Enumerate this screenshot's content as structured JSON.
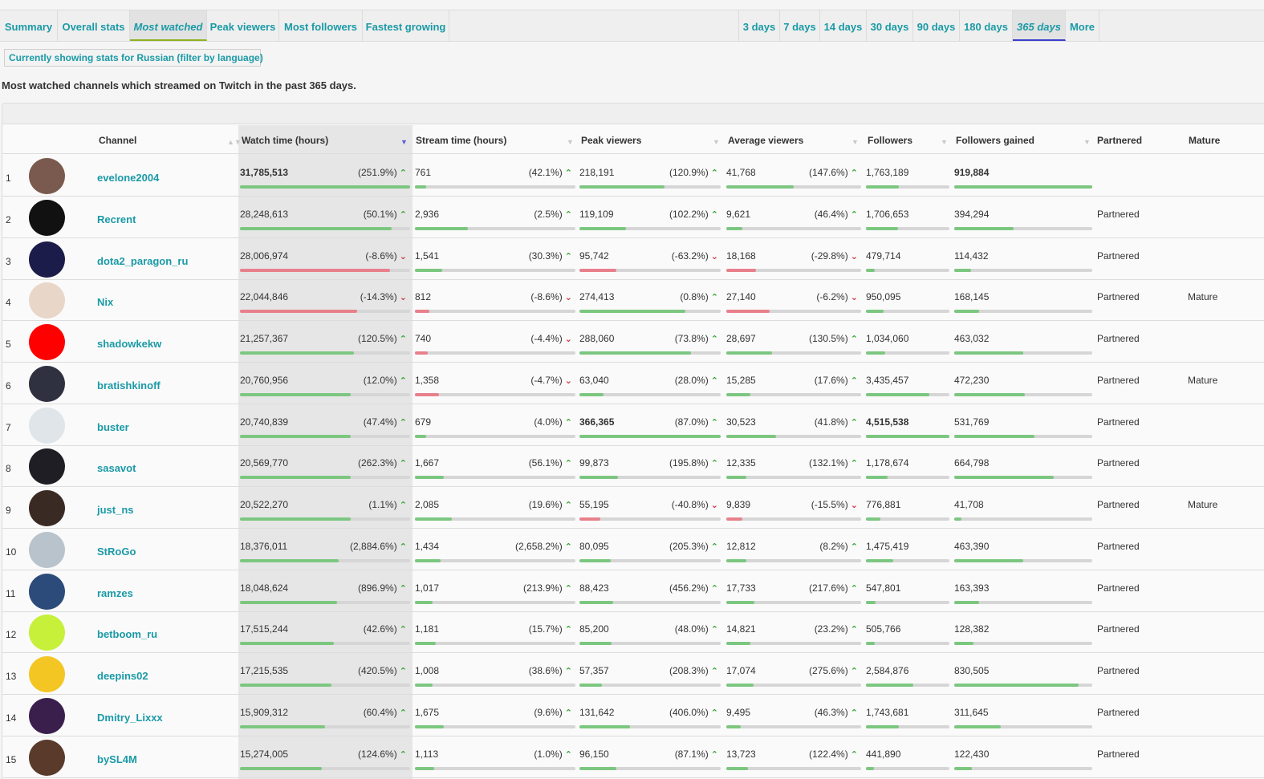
{
  "nav": {
    "left_tabs": [
      "Summary",
      "Overall stats",
      "Most watched",
      "Peak viewers",
      "Most followers",
      "Fastest growing"
    ],
    "right_tabs": [
      "3 days",
      "7 days",
      "14 days",
      "30 days",
      "90 days",
      "180 days",
      "365 days",
      "More"
    ],
    "active_left": "Most watched",
    "active_right": "365 days"
  },
  "filter_label": "Currently showing stats for Russian (filter by language)",
  "description": "Most watched channels which streamed on Twitch in the past 365 days.",
  "columns": {
    "channel": "Channel",
    "watch": "Watch time (hours)",
    "stream": "Stream time (hours)",
    "peak": "Peak viewers",
    "avg": "Average viewers",
    "followers": "Followers",
    "gained": "Followers gained",
    "partnered": "Partnered",
    "mature": "Mature"
  },
  "colors": {
    "link": "#1a9aa6",
    "bar_positive": "#7cc780",
    "bar_negative": "#e8808c",
    "arrow_up": "#2aa02a",
    "arrow_down": "#cf2a3a"
  },
  "rows": [
    {
      "rank": "1",
      "channel": "evelone2004",
      "avatar": "avatar-icon",
      "avatar_color": "#7a5a4e",
      "watch": {
        "value": "31,785,513",
        "pct": "(251.9%)",
        "dir": "up",
        "bar": 1.0,
        "bold": true
      },
      "stream": {
        "value": "761",
        "pct": "(42.1%)",
        "dir": "up",
        "bar": 0.07
      },
      "peak": {
        "value": "218,191",
        "pct": "(120.9%)",
        "dir": "up",
        "bar": 0.6
      },
      "avg": {
        "value": "41,768",
        "pct": "(147.6%)",
        "dir": "up",
        "bar": 0.5
      },
      "followers": {
        "value": "1,763,189",
        "bar": 0.39
      },
      "gained": {
        "value": "919,884",
        "bar": 1.0,
        "bold": true
      },
      "partnered": "",
      "mature": ""
    },
    {
      "rank": "2",
      "channel": "Recrent",
      "avatar": "avatar-icon",
      "avatar_color": "#111111",
      "watch": {
        "value": "28,248,613",
        "pct": "(50.1%)",
        "dir": "up",
        "bar": 0.89
      },
      "stream": {
        "value": "2,936",
        "pct": "(2.5%)",
        "dir": "up",
        "bar": 0.33
      },
      "peak": {
        "value": "119,109",
        "pct": "(102.2%)",
        "dir": "up",
        "bar": 0.33
      },
      "avg": {
        "value": "9,621",
        "pct": "(46.4%)",
        "dir": "up",
        "bar": 0.12
      },
      "followers": {
        "value": "1,706,653",
        "bar": 0.38
      },
      "gained": {
        "value": "394,294",
        "bar": 0.43
      },
      "partnered": "Partnered",
      "mature": ""
    },
    {
      "rank": "3",
      "channel": "dota2_paragon_ru",
      "avatar": "avatar-icon",
      "avatar_color": "#1c1c4a",
      "watch": {
        "value": "28,006,974",
        "pct": "(-8.6%)",
        "dir": "down",
        "bar": 0.88
      },
      "stream": {
        "value": "1,541",
        "pct": "(30.3%)",
        "dir": "up",
        "bar": 0.17
      },
      "peak": {
        "value": "95,742",
        "pct": "(-63.2%)",
        "dir": "down",
        "bar": 0.26
      },
      "avg": {
        "value": "18,168",
        "pct": "(-29.8%)",
        "dir": "down",
        "bar": 0.22
      },
      "followers": {
        "value": "479,714",
        "bar": 0.11
      },
      "gained": {
        "value": "114,432",
        "bar": 0.12
      },
      "partnered": "Partnered",
      "mature": ""
    },
    {
      "rank": "4",
      "channel": "Nix",
      "avatar": "avatar-icon",
      "avatar_color": "#e8d6c8",
      "watch": {
        "value": "22,044,846",
        "pct": "(-14.3%)",
        "dir": "down",
        "bar": 0.69
      },
      "stream": {
        "value": "812",
        "pct": "(-8.6%)",
        "dir": "down",
        "bar": 0.09
      },
      "peak": {
        "value": "274,413",
        "pct": "(0.8%)",
        "dir": "up",
        "bar": 0.75
      },
      "avg": {
        "value": "27,140",
        "pct": "(-6.2%)",
        "dir": "down",
        "bar": 0.32
      },
      "followers": {
        "value": "950,095",
        "bar": 0.21
      },
      "gained": {
        "value": "168,145",
        "bar": 0.18
      },
      "partnered": "Partnered",
      "mature": "Mature"
    },
    {
      "rank": "5",
      "channel": "shadowkekw",
      "avatar": "avatar-icon",
      "avatar_color": "#ff0000",
      "watch": {
        "value": "21,257,367",
        "pct": "(120.5%)",
        "dir": "up",
        "bar": 0.67
      },
      "stream": {
        "value": "740",
        "pct": "(-4.4%)",
        "dir": "down",
        "bar": 0.08
      },
      "peak": {
        "value": "288,060",
        "pct": "(73.8%)",
        "dir": "up",
        "bar": 0.79
      },
      "avg": {
        "value": "28,697",
        "pct": "(130.5%)",
        "dir": "up",
        "bar": 0.34
      },
      "followers": {
        "value": "1,034,060",
        "bar": 0.23
      },
      "gained": {
        "value": "463,032",
        "bar": 0.5
      },
      "partnered": "Partnered",
      "mature": ""
    },
    {
      "rank": "6",
      "channel": "bratishkinoff",
      "avatar": "avatar-icon",
      "avatar_color": "#2f3140",
      "watch": {
        "value": "20,760,956",
        "pct": "(12.0%)",
        "dir": "up",
        "bar": 0.65
      },
      "stream": {
        "value": "1,358",
        "pct": "(-4.7%)",
        "dir": "down",
        "bar": 0.15
      },
      "peak": {
        "value": "63,040",
        "pct": "(28.0%)",
        "dir": "up",
        "bar": 0.17
      },
      "avg": {
        "value": "15,285",
        "pct": "(17.6%)",
        "dir": "up",
        "bar": 0.18
      },
      "followers": {
        "value": "3,435,457",
        "bar": 0.76
      },
      "gained": {
        "value": "472,230",
        "bar": 0.51
      },
      "partnered": "Partnered",
      "mature": "Mature"
    },
    {
      "rank": "7",
      "channel": "buster",
      "avatar": "avatar-icon",
      "avatar_color": "#dfe5e8",
      "watch": {
        "value": "20,740,839",
        "pct": "(47.4%)",
        "dir": "up",
        "bar": 0.65
      },
      "stream": {
        "value": "679",
        "pct": "(4.0%)",
        "dir": "up",
        "bar": 0.07
      },
      "peak": {
        "value": "366,365",
        "pct": "(87.0%)",
        "dir": "up",
        "bar": 1.0,
        "bold": true
      },
      "avg": {
        "value": "30,523",
        "pct": "(41.8%)",
        "dir": "up",
        "bar": 0.37
      },
      "followers": {
        "value": "4,515,538",
        "bar": 1.0,
        "bold": true
      },
      "gained": {
        "value": "531,769",
        "bar": 0.58
      },
      "partnered": "Partnered",
      "mature": ""
    },
    {
      "rank": "8",
      "channel": "sasavot",
      "avatar": "avatar-icon",
      "avatar_color": "#1e1e24",
      "watch": {
        "value": "20,569,770",
        "pct": "(262.3%)",
        "dir": "up",
        "bar": 0.65
      },
      "stream": {
        "value": "1,667",
        "pct": "(56.1%)",
        "dir": "up",
        "bar": 0.18
      },
      "peak": {
        "value": "99,873",
        "pct": "(195.8%)",
        "dir": "up",
        "bar": 0.27
      },
      "avg": {
        "value": "12,335",
        "pct": "(132.1%)",
        "dir": "up",
        "bar": 0.15
      },
      "followers": {
        "value": "1,178,674",
        "bar": 0.26
      },
      "gained": {
        "value": "664,798",
        "bar": 0.72
      },
      "partnered": "Partnered",
      "mature": ""
    },
    {
      "rank": "9",
      "channel": "just_ns",
      "avatar": "avatar-icon",
      "avatar_color": "#3a2a24",
      "watch": {
        "value": "20,522,270",
        "pct": "(1.1%)",
        "dir": "up",
        "bar": 0.65
      },
      "stream": {
        "value": "2,085",
        "pct": "(19.6%)",
        "dir": "up",
        "bar": 0.23
      },
      "peak": {
        "value": "55,195",
        "pct": "(-40.8%)",
        "dir": "down",
        "bar": 0.15
      },
      "avg": {
        "value": "9,839",
        "pct": "(-15.5%)",
        "dir": "down",
        "bar": 0.12
      },
      "followers": {
        "value": "776,881",
        "bar": 0.17
      },
      "gained": {
        "value": "41,708",
        "bar": 0.05
      },
      "partnered": "Partnered",
      "mature": "Mature"
    },
    {
      "rank": "10",
      "channel": "StRoGo",
      "avatar": "avatar-icon",
      "avatar_color": "#b9c3cc",
      "watch": {
        "value": "18,376,011",
        "pct": "(2,884.6%)",
        "dir": "up",
        "bar": 0.58
      },
      "stream": {
        "value": "1,434",
        "pct": "(2,658.2%)",
        "dir": "up",
        "bar": 0.16
      },
      "peak": {
        "value": "80,095",
        "pct": "(205.3%)",
        "dir": "up",
        "bar": 0.22
      },
      "avg": {
        "value": "12,812",
        "pct": "(8.2%)",
        "dir": "up",
        "bar": 0.15
      },
      "followers": {
        "value": "1,475,419",
        "bar": 0.33
      },
      "gained": {
        "value": "463,390",
        "bar": 0.5
      },
      "partnered": "Partnered",
      "mature": ""
    },
    {
      "rank": "11",
      "channel": "ramzes",
      "avatar": "avatar-icon",
      "avatar_color": "#2c4b7a",
      "watch": {
        "value": "18,048,624",
        "pct": "(896.9%)",
        "dir": "up",
        "bar": 0.57
      },
      "stream": {
        "value": "1,017",
        "pct": "(213.9%)",
        "dir": "up",
        "bar": 0.11
      },
      "peak": {
        "value": "88,423",
        "pct": "(456.2%)",
        "dir": "up",
        "bar": 0.24
      },
      "avg": {
        "value": "17,733",
        "pct": "(217.6%)",
        "dir": "up",
        "bar": 0.21
      },
      "followers": {
        "value": "547,801",
        "bar": 0.12
      },
      "gained": {
        "value": "163,393",
        "bar": 0.18
      },
      "partnered": "Partnered",
      "mature": ""
    },
    {
      "rank": "12",
      "channel": "betboom_ru",
      "avatar": "avatar-icon",
      "avatar_color": "#c6f03a",
      "watch": {
        "value": "17,515,244",
        "pct": "(42.6%)",
        "dir": "up",
        "bar": 0.55
      },
      "stream": {
        "value": "1,181",
        "pct": "(15.7%)",
        "dir": "up",
        "bar": 0.13
      },
      "peak": {
        "value": "85,200",
        "pct": "(48.0%)",
        "dir": "up",
        "bar": 0.23
      },
      "avg": {
        "value": "14,821",
        "pct": "(23.2%)",
        "dir": "up",
        "bar": 0.18
      },
      "followers": {
        "value": "505,766",
        "bar": 0.11
      },
      "gained": {
        "value": "128,382",
        "bar": 0.14
      },
      "partnered": "Partnered",
      "mature": ""
    },
    {
      "rank": "13",
      "channel": "deepins02",
      "avatar": "avatar-icon",
      "avatar_color": "#f3c623",
      "watch": {
        "value": "17,215,535",
        "pct": "(420.5%)",
        "dir": "up",
        "bar": 0.54
      },
      "stream": {
        "value": "1,008",
        "pct": "(38.6%)",
        "dir": "up",
        "bar": 0.11
      },
      "peak": {
        "value": "57,357",
        "pct": "(208.3%)",
        "dir": "up",
        "bar": 0.16
      },
      "avg": {
        "value": "17,074",
        "pct": "(275.6%)",
        "dir": "up",
        "bar": 0.2
      },
      "followers": {
        "value": "2,584,876",
        "bar": 0.57
      },
      "gained": {
        "value": "830,505",
        "bar": 0.9
      },
      "partnered": "Partnered",
      "mature": ""
    },
    {
      "rank": "14",
      "channel": "Dmitry_Lixxx",
      "avatar": "avatar-icon",
      "avatar_color": "#3a1f4d",
      "watch": {
        "value": "15,909,312",
        "pct": "(60.4%)",
        "dir": "up",
        "bar": 0.5
      },
      "stream": {
        "value": "1,675",
        "pct": "(9.6%)",
        "dir": "up",
        "bar": 0.18
      },
      "peak": {
        "value": "131,642",
        "pct": "(406.0%)",
        "dir": "up",
        "bar": 0.36
      },
      "avg": {
        "value": "9,495",
        "pct": "(46.3%)",
        "dir": "up",
        "bar": 0.11
      },
      "followers": {
        "value": "1,743,681",
        "bar": 0.39
      },
      "gained": {
        "value": "311,645",
        "bar": 0.34
      },
      "partnered": "Partnered",
      "mature": ""
    },
    {
      "rank": "15",
      "channel": "bySL4M",
      "avatar": "avatar-icon",
      "avatar_color": "#5a3a2a",
      "watch": {
        "value": "15,274,005",
        "pct": "(124.6%)",
        "dir": "up",
        "bar": 0.48
      },
      "stream": {
        "value": "1,113",
        "pct": "(1.0%)",
        "dir": "up",
        "bar": 0.12
      },
      "peak": {
        "value": "96,150",
        "pct": "(87.1%)",
        "dir": "up",
        "bar": 0.26
      },
      "avg": {
        "value": "13,723",
        "pct": "(122.4%)",
        "dir": "up",
        "bar": 0.16
      },
      "followers": {
        "value": "441,890",
        "bar": 0.1
      },
      "gained": {
        "value": "122,430",
        "bar": 0.13
      },
      "partnered": "Partnered",
      "mature": ""
    }
  ]
}
